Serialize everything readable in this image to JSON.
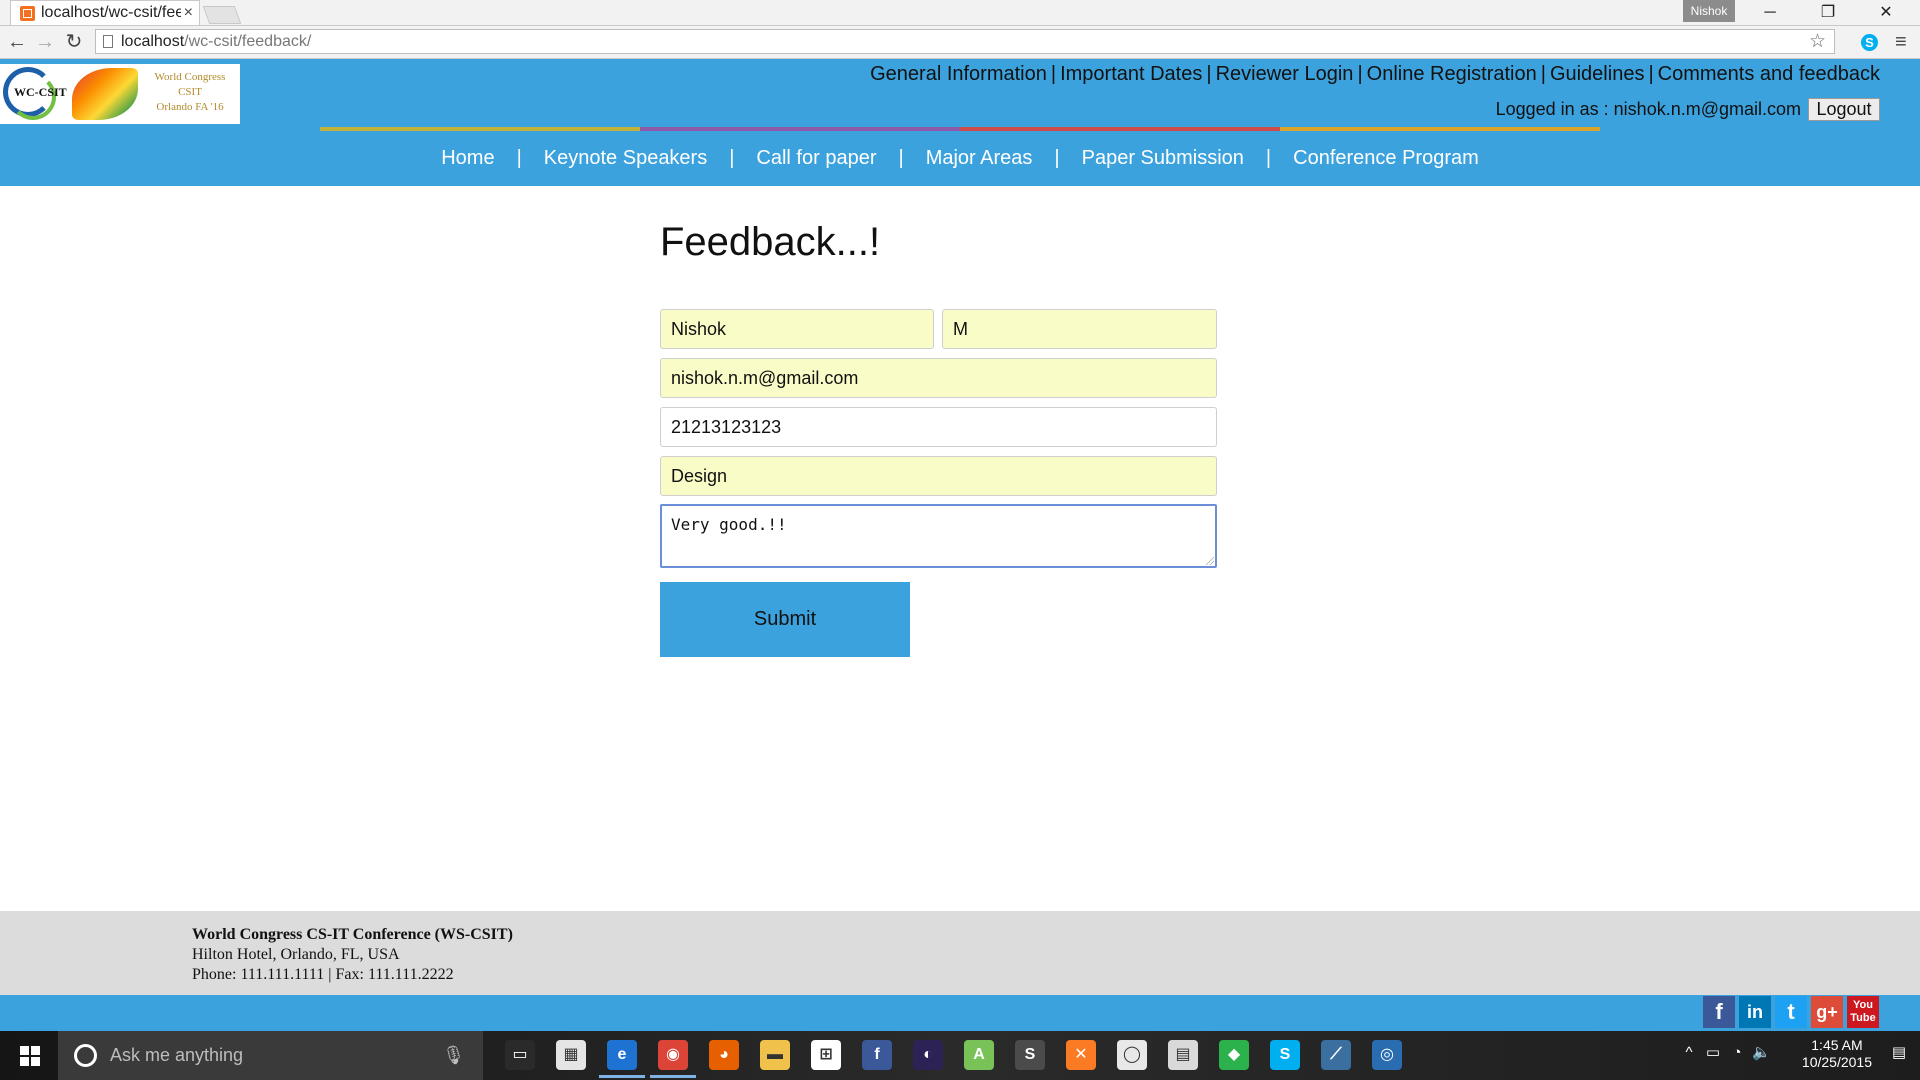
{
  "browser": {
    "tab_title": "localhost/wc-csit/fee",
    "tab_close": "×",
    "profile_name": "Nishok",
    "url_host": "localhost",
    "url_path": "/wc-csit/feedback/",
    "back_glyph": "←",
    "forward_glyph": "→",
    "reload_glyph": "↻",
    "star_glyph": "☆",
    "menu_glyph": "≡",
    "skype_glyph": "S",
    "minimize_glyph": "─",
    "restore_glyph": "❐",
    "close_glyph": "✕"
  },
  "logo": {
    "abbr": "WC-CSIT",
    "line1": "World Congress",
    "line2": "CSIT",
    "line3": "Orlando FA '16"
  },
  "top_links": [
    "General Information",
    "Important Dates",
    "Reviewer Login",
    "Online Registration",
    "Guidelines",
    "Comments and feedback"
  ],
  "separator": "|",
  "user": {
    "logged_in_text": "Logged in as : nishok.n.m@gmail.com",
    "logout_label": "Logout"
  },
  "main_nav": [
    "Home",
    "Keynote Speakers",
    "Call for paper",
    "Major Areas",
    "Paper Submission",
    "Conference Program"
  ],
  "colors": {
    "header_blue": "#3ca2dd",
    "autofill_yellow": "#fafcc8",
    "stripe": [
      "#3ca2dd",
      "#c3b23a",
      "#8e5aa8",
      "#d14b4b",
      "#d9a429",
      "#3ca2dd"
    ]
  },
  "form": {
    "title": "Feedback...!",
    "first_name": "Nishok",
    "last_name": "M",
    "email": "nishok.n.m@gmail.com",
    "phone": "21213123123",
    "subject": "Design",
    "comment": "Very good.!!",
    "submit_label": "Submit"
  },
  "footer": {
    "org": "World Congress CS-IT Conference (WS-CSIT)",
    "address": "Hilton Hotel, Orlando, FL, USA",
    "phone_fax": "Phone: 111.111.1111 | Fax: 111.111.2222"
  },
  "social": [
    {
      "name": "facebook",
      "glyph": "f",
      "color": "#3b5998"
    },
    {
      "name": "linkedin",
      "glyph": "in",
      "color": "#0077b5"
    },
    {
      "name": "twitter",
      "glyph": "t",
      "color": "#1da1f2"
    },
    {
      "name": "google-plus",
      "glyph": "g+",
      "color": "#dd4b39"
    },
    {
      "name": "youtube",
      "glyph": "You Tube",
      "color": "#cc181e"
    }
  ],
  "taskbar": {
    "search_placeholder": "Ask me anything",
    "mic_glyph": "🎙",
    "apps": [
      {
        "name": "task-view-icon",
        "color": "#2a2a2a",
        "label": "▭",
        "active": false
      },
      {
        "name": "store-apps-icon",
        "color": "#e5e5e5",
        "label": "▦",
        "active": false
      },
      {
        "name": "edge-icon",
        "color": "#1e73d2",
        "label": "e",
        "active": true
      },
      {
        "name": "chrome-icon",
        "color": "#db4437",
        "label": "◉",
        "active": true
      },
      {
        "name": "firefox-icon",
        "color": "#e66000",
        "label": "◕",
        "active": false
      },
      {
        "name": "file-explorer-icon",
        "color": "#f0c24b",
        "label": "▬",
        "active": false
      },
      {
        "name": "windows-store-icon",
        "color": "#ffffff",
        "label": "⊞",
        "active": false
      },
      {
        "name": "facebook-app-icon",
        "color": "#3b5998",
        "label": "f",
        "active": false
      },
      {
        "name": "eclipse-icon",
        "color": "#2c2255",
        "label": "◐",
        "active": false
      },
      {
        "name": "android-studio-icon",
        "color": "#78c257",
        "label": "A",
        "active": false
      },
      {
        "name": "sublime-icon",
        "color": "#4b4b4b",
        "label": "S",
        "active": false
      },
      {
        "name": "xampp-icon",
        "color": "#fb7a24",
        "label": "✕",
        "active": false
      },
      {
        "name": "github-icon",
        "color": "#e8e8e8",
        "label": "◯",
        "active": false
      },
      {
        "name": "network-drive-icon",
        "color": "#d9d9d9",
        "label": "▤",
        "active": false
      },
      {
        "name": "feedly-icon",
        "color": "#2bb24c",
        "label": "◆",
        "active": false
      },
      {
        "name": "skype-icon",
        "color": "#00aff0",
        "label": "S",
        "active": false
      },
      {
        "name": "mysql-icon",
        "color": "#3a6fa0",
        "label": "⟋",
        "active": false
      },
      {
        "name": "globe-app-icon",
        "color": "#2a6cb0",
        "label": "◎",
        "active": false
      }
    ],
    "tray": [
      "^",
      "▭",
      "◔",
      "🔈",
      "▤"
    ],
    "time": "1:45 AM",
    "date": "10/25/2015"
  }
}
